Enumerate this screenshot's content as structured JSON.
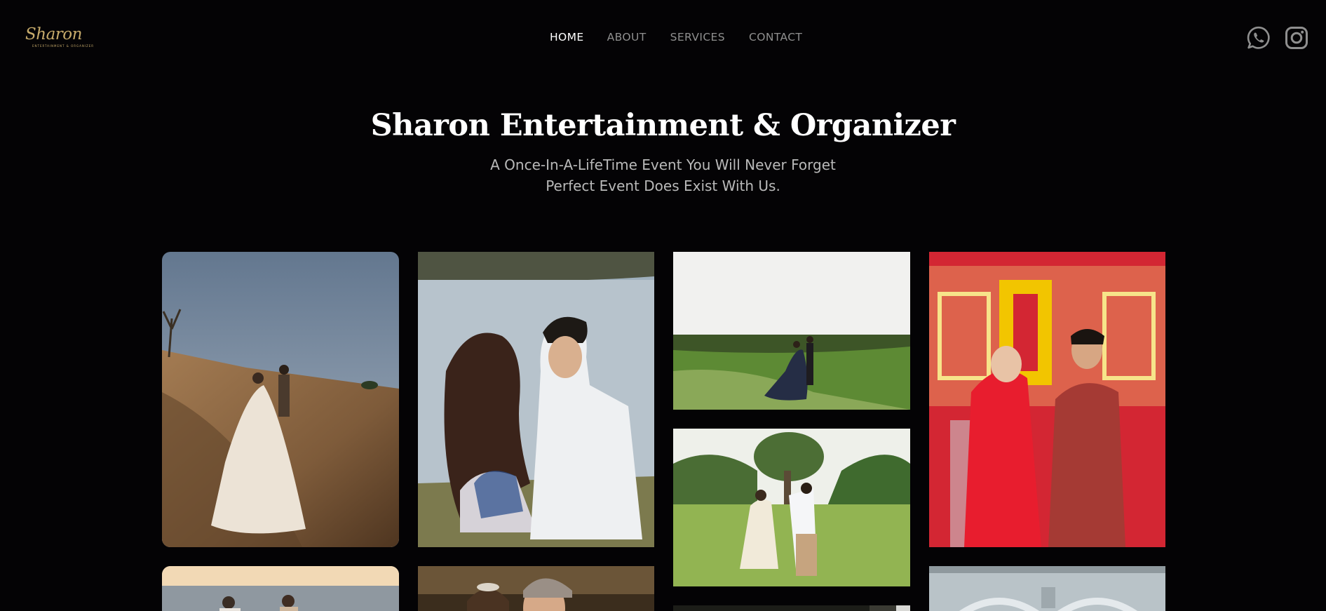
{
  "brand": {
    "logo_text": "Sharon",
    "logo_subtext": "ENTERTAINMENT & ORGANIZER",
    "accent_color": "#c7ab6b"
  },
  "nav": {
    "items": [
      {
        "label": "HOME",
        "active": true
      },
      {
        "label": "ABOUT",
        "active": false
      },
      {
        "label": "SERVICES",
        "active": false
      },
      {
        "label": "CONTACT",
        "active": false
      }
    ]
  },
  "social": {
    "icons": [
      "whatsapp-icon",
      "instagram-icon"
    ]
  },
  "hero": {
    "title": "Sharon Entertainment & Organizer",
    "subtitle_line1": "A Once-In-A-LifeTime Event You Will Never Forget",
    "subtitle_line2": "Perfect Event Does Exist With Us."
  },
  "gallery": {
    "photos": [
      {
        "scene": "couple walking on desert dunes, bride in lace gown"
      },
      {
        "scene": "couple sitting by a lake, woman in floral dress"
      },
      {
        "scene": "couple holding hands on green hilltop"
      },
      {
        "scene": "couple in red cheongsam before double-happiness backdrop"
      },
      {
        "scene": "couple dancing on park lawn under a tree"
      },
      {
        "scene": "couple on beach at sunset"
      },
      {
        "scene": "couple embracing, bride wearing tiara"
      },
      {
        "scene": "dark indoor scene"
      },
      {
        "scene": "ornate white building facade"
      }
    ]
  }
}
